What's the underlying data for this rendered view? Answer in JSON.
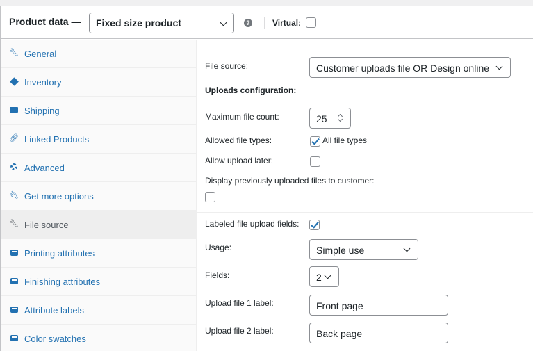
{
  "header": {
    "title": "Product data —",
    "product_type": "Fixed size product",
    "help_glyph": "?",
    "virtual_label": "Virtual:",
    "virtual_checked": false
  },
  "sidebar": {
    "items": [
      {
        "label": "General",
        "icon": "wrench-icon",
        "active": false
      },
      {
        "label": "Inventory",
        "icon": "tag-icon",
        "active": false
      },
      {
        "label": "Shipping",
        "icon": "truck-icon",
        "active": false
      },
      {
        "label": "Linked Products",
        "icon": "link-icon",
        "active": false
      },
      {
        "label": "Advanced",
        "icon": "gear-icon",
        "active": false
      },
      {
        "label": "Get more options",
        "icon": "plug-icon",
        "active": false
      },
      {
        "label": "File source",
        "icon": "wrench-icon",
        "active": true
      },
      {
        "label": "Printing attributes",
        "icon": "list-box-icon",
        "active": false
      },
      {
        "label": "Finishing attributes",
        "icon": "list-box-icon",
        "active": false
      },
      {
        "label": "Attribute labels",
        "icon": "list-box-icon",
        "active": false
      },
      {
        "label": "Color swatches",
        "icon": "list-box-icon",
        "active": false
      }
    ]
  },
  "file_source": {
    "file_source_label": "File source:",
    "file_source_value": "Customer uploads file OR Design online",
    "uploads_heading": "Uploads configuration:",
    "max_count_label": "Maximum file count:",
    "max_count_value": "25",
    "allowed_types_label": "Allowed file types:",
    "all_types_label": "All file types",
    "all_types_checked": true,
    "upload_later_label": "Allow upload later:",
    "upload_later_checked": false,
    "display_prev_label": "Display previously uploaded files to customer:",
    "display_prev_checked": false,
    "labeled_fields_label": "Labeled file upload fields:",
    "labeled_fields_checked": true,
    "usage_label": "Usage:",
    "usage_value": "Simple use",
    "fields_label": "Fields:",
    "fields_value": "2",
    "file1_label": "Upload file 1 label:",
    "file1_value": "Front page",
    "file2_label": "Upload file 2 label:",
    "file2_value": "Back page"
  },
  "colors": {
    "link": "#2271b1",
    "active_tab_bg": "#eeeeee",
    "border": "#8c8f94"
  }
}
